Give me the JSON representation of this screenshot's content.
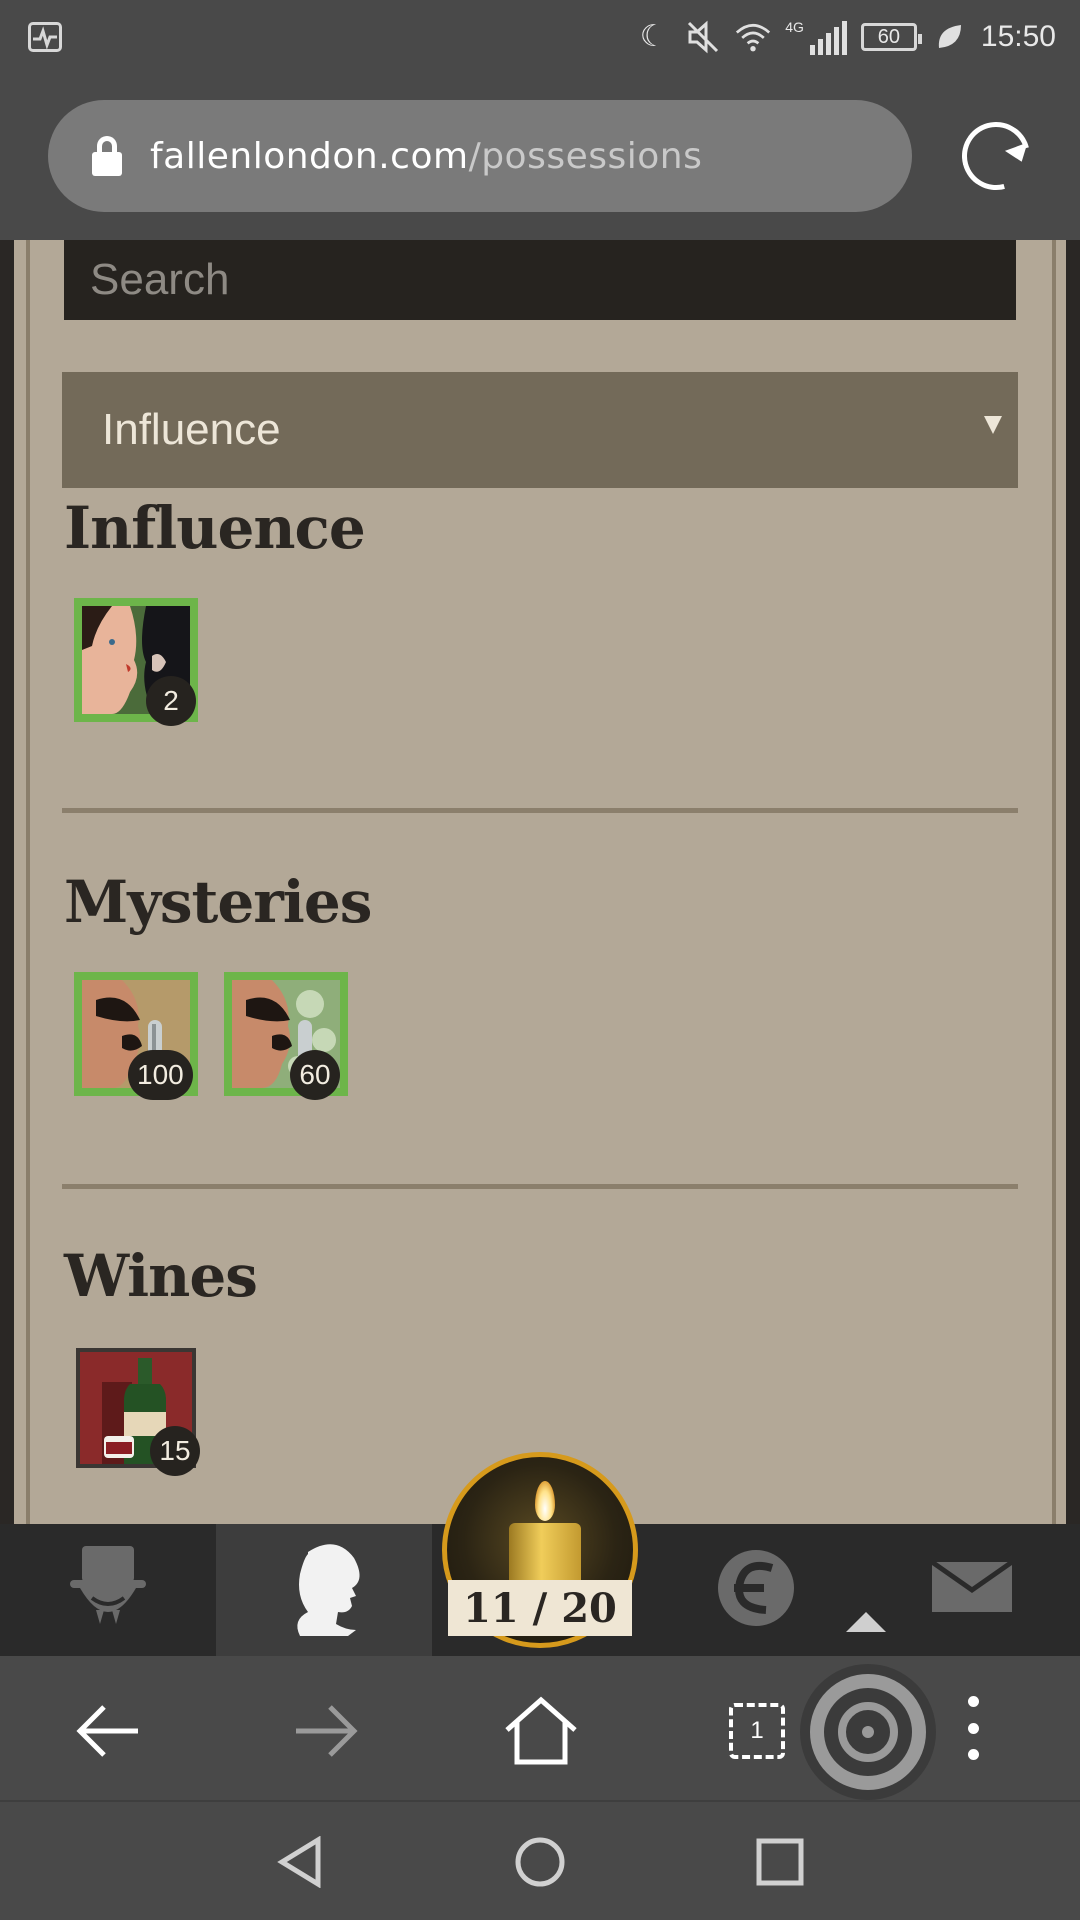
{
  "status_bar": {
    "time": "15:50",
    "battery": "60",
    "network": "4G"
  },
  "browser": {
    "url_host": "fallenlondon.com",
    "url_path": "/possessions",
    "tab_count": "1"
  },
  "possessions": {
    "search_placeholder": "Search",
    "category_selected": "Influence",
    "sections": [
      {
        "title": "Influence",
        "items": [
          {
            "count": "2",
            "icon": "whispering-faces-icon"
          }
        ]
      },
      {
        "title": "Mysteries",
        "items": [
          {
            "count": "100",
            "icon": "whispered-secret-icon"
          },
          {
            "count": "60",
            "icon": "appalling-secret-icon"
          }
        ]
      },
      {
        "title": "Wines",
        "items": [
          {
            "count": "15",
            "icon": "wine-bottle-icon"
          }
        ]
      }
    ]
  },
  "game_nav": {
    "actions_label": "11 / 20",
    "tabs": [
      "top-hat-villain-icon",
      "profile-head-icon",
      "candle-icon",
      "echo-currency-icon",
      "mail-icon"
    ]
  },
  "colors": {
    "paper": "#b3a897",
    "owned_border": "#6db54a",
    "dropdown": "#736a59",
    "candle_ring": "#d69a1c"
  }
}
